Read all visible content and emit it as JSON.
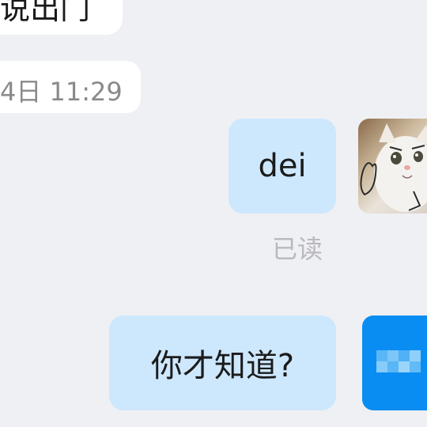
{
  "messages": {
    "partial_incoming_text": "说出门",
    "timestamp": "4日 11:29",
    "outgoing_1": "dei",
    "read_status": "已读",
    "outgoing_2": "你才知道?"
  },
  "colors": {
    "background": "#eff0f3",
    "incoming_bubble": "#ffffff",
    "outgoing_bubble": "#cde7fd",
    "avatar_blue": "#0a8df2",
    "read_status": "#b9b9bd",
    "timestamp_text": "#8a8a8a"
  },
  "avatars": {
    "self_icon": "cat-avatar-icon",
    "other_icon": "blurred-avatar-icon"
  }
}
